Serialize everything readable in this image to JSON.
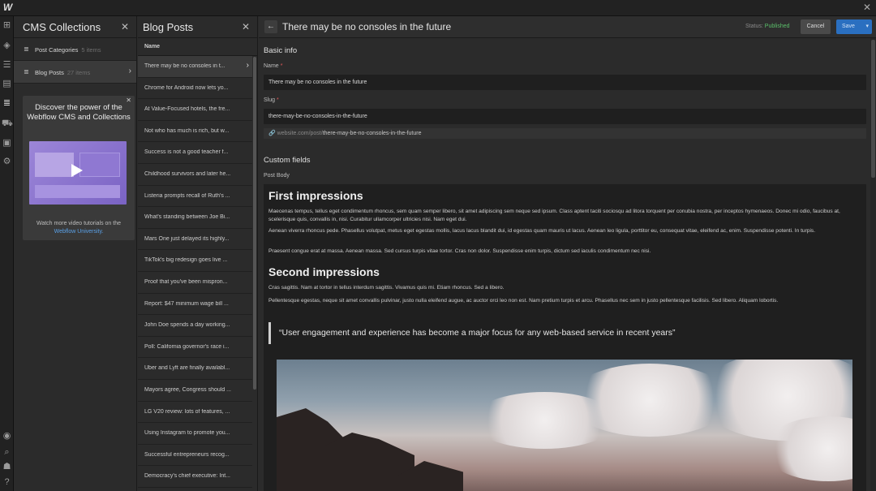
{
  "app": {
    "logo": "W"
  },
  "cms_panel": {
    "title": "CMS Collections",
    "collections": [
      {
        "name": "Post Categories",
        "count": "5 items"
      },
      {
        "name": "Blog Posts",
        "count": "27 items"
      }
    ],
    "promo": {
      "title": "Discover the power of the Webflow CMS and Collections",
      "footer_text": "Watch more video tutorials on the",
      "footer_link": "Webflow University."
    }
  },
  "posts_panel": {
    "title": "Blog Posts",
    "column_header": "Name",
    "items": [
      "There may be no consoles in t...",
      "Chrome for Android now lets yo...",
      "At Value-Focused hotels, the fre...",
      "Not who has much is rich, but w...",
      "Success is not a good teacher f...",
      "Childhood survivors and later he...",
      "Listeria prompts recall of Ruth's ...",
      "What's standing between Joe Bi...",
      "Mars One just delayed its highly...",
      "TikTok's big redesign goes live ...",
      "Proof that you've been mispron...",
      "Report: $47 minimum wage bill ...",
      "John Doe spends a day working...",
      "Poll: California governor's race i...",
      "Uber and Lyft are finally availabl...",
      "Mayors agree, Congress should ...",
      "LG V20 review: lots of features, ...",
      "Using Instagram to promote you...",
      "Successful entrepreneurs recog...",
      "Democracy's chief executive: Int..."
    ]
  },
  "editor": {
    "title": "There may be no consoles in the future",
    "status_label": "Status:",
    "status_value": "Published",
    "cancel_label": "Cancel",
    "save_label": "Save",
    "colors": {
      "published": "#5bbf6a",
      "save": "#2a6fc0",
      "required": "#e35a5a"
    },
    "basic_info": {
      "heading": "Basic info",
      "name_label": "Name",
      "name_value": "There may be no consoles in the future",
      "slug_label": "Slug",
      "slug_value": "there-may-be-no-consoles-in-the-future",
      "url_prefix": "website.com/post/",
      "url_slug": "there-may-be-no-consoles-in-the-future"
    },
    "custom_fields": {
      "heading": "Custom fields",
      "post_body_label": "Post Body",
      "h1": "First impressions",
      "p1": "Maecenas tempus, tellus eget condimentum rhoncus, sem quam semper libero, sit amet adipiscing sem neque sed ipsum. Class aptent taciti sociosqu ad litora torquent per conubia nostra, per inceptos hymenaeos. Donec mi odio, faucibus at, scelerisque quis, convallis in, nisi. Curabitur ullamcorper ultricies nisi. Nam eget dui.",
      "p2": "Aenean viverra rhoncus pede. Phasellus volutpat, metus eget egestas mollis, lacus lacus blandit dui, id egestas quam mauris ut lacus. Aenean leo ligula, porttitor eu, consequat vitae, eleifend ac, enim. Suspendisse potenti. In turpis.",
      "p3": "Praesent congue erat at massa. Aenean massa. Sed cursus turpis vitae tortor. Cras non dolor. Suspendisse enim turpis, dictum sed iaculis condimentum nec nisi.",
      "h2": "Second impressions",
      "p4": "Cras sagittis. Nam at tortor in tellus interdum sagittis. Vivamus quis mi. Etiam rhoncus. Sed a libero.",
      "p5": "Pellentesque egestas, neque sit amet convallis pulvinar, justo nulla eleifend augue, ac auctor orci leo non est. Nam pretium turpis et arcu. Phasellus nec sem in justo pellentesque facilisis. Sed libero. Aliquam lobortis.",
      "quote": "“User engagement and experience has become a major focus for any web-based service in recent years”"
    }
  }
}
